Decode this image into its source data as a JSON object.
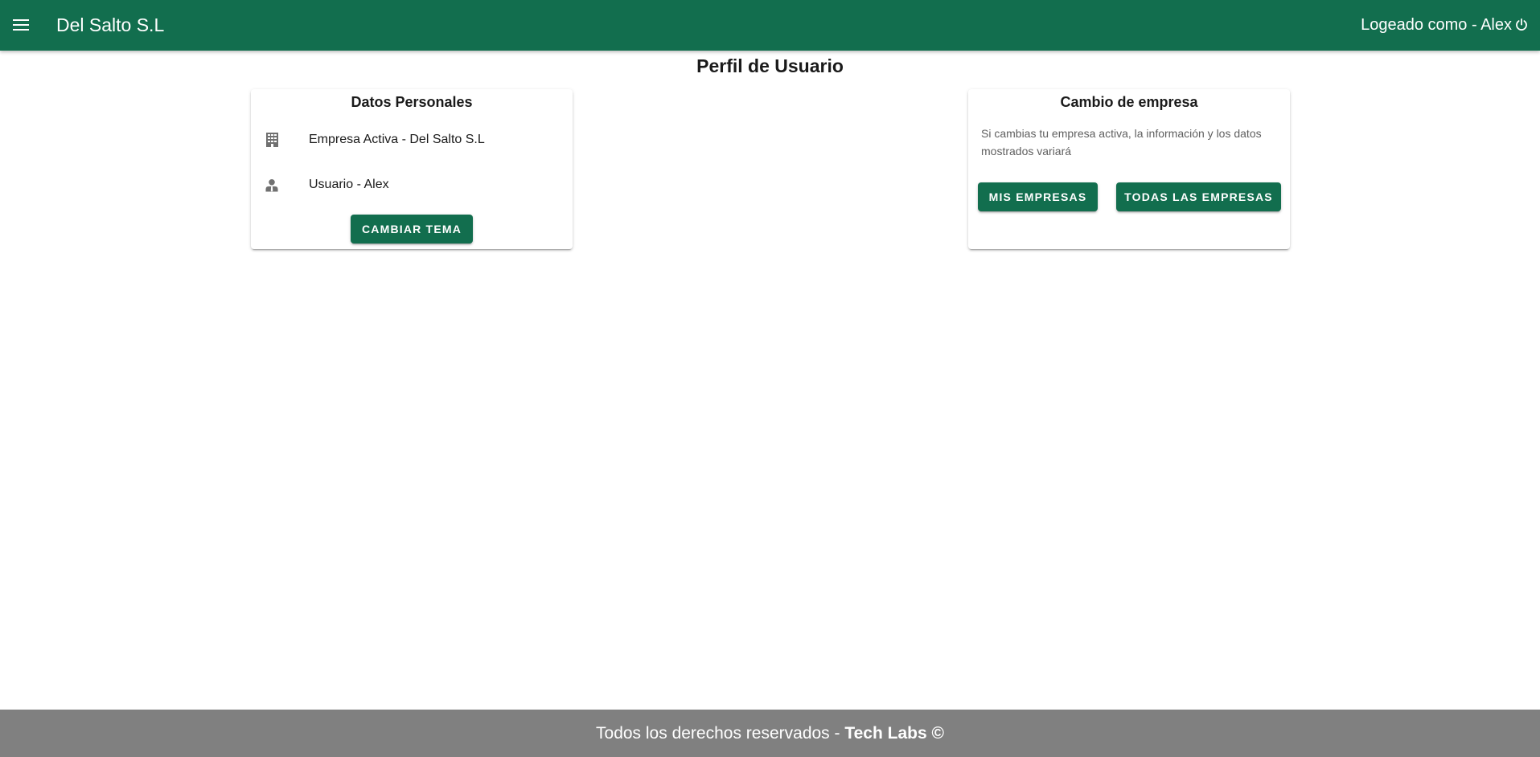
{
  "appbar": {
    "title": "Del Salto S.L",
    "user_label": "Logeado como - Alex",
    "background": "#126e4e",
    "icons": {
      "menu": "menu-icon",
      "logout": "power-icon"
    }
  },
  "page": {
    "title": "Perfil de Usuario"
  },
  "personal_card": {
    "title": "Datos Personales",
    "company_line": "Empresa Activa - Del Salto S.L",
    "user_line": "Usuario - Alex",
    "theme_button": "CAMBIAR TEMA",
    "icons": {
      "company": "building-icon",
      "user": "user-icon"
    }
  },
  "company_card": {
    "title": "Cambio de empresa",
    "description": "Si cambias tu empresa activa, la información y los datos mostrados variará",
    "my_companies_button": "MIS EMPRESAS",
    "all_companies_button": "TODAS LAS EMPRESAS"
  },
  "footer": {
    "text": "Todos los derechos reservados - ",
    "brand": "Tech Labs ©",
    "background": "#808080"
  }
}
